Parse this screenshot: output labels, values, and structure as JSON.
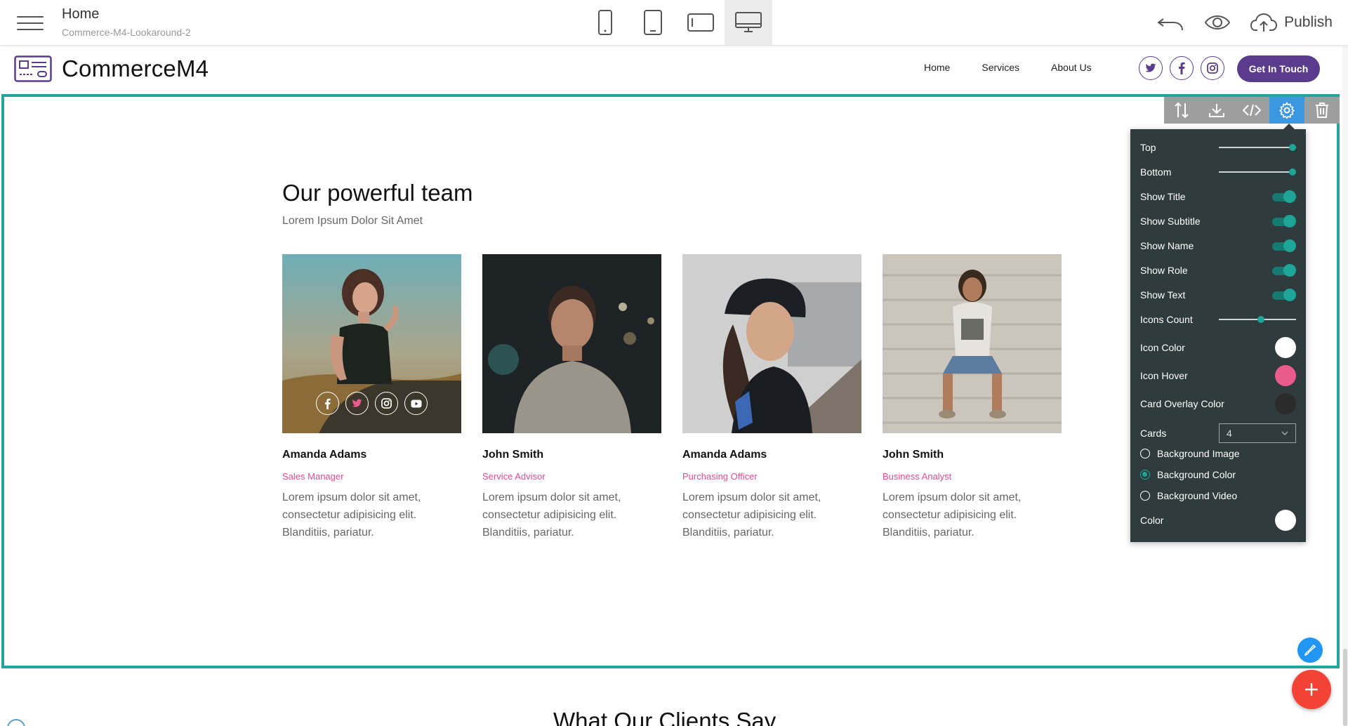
{
  "editor": {
    "page_title": "Home",
    "project_name": "Commerce-M4-Lookaround-2",
    "publish_label": "Publish"
  },
  "site": {
    "brand": "CommerceM4",
    "nav": [
      "Home",
      "Services",
      "About Us"
    ],
    "cta": "Get In Touch"
  },
  "team": {
    "title": "Our powerful team",
    "subtitle": "Lorem Ipsum Dolor Sit Amet",
    "members": [
      {
        "name": "Amanda Adams",
        "role": "Sales Manager",
        "text": "Lorem ipsum dolor sit amet, consectetur adipisicing elit. Blanditiis, pariatur."
      },
      {
        "name": "John Smith",
        "role": "Service Advisor",
        "text": "Lorem ipsum dolor sit amet, consectetur adipisicing elit. Blanditiis, pariatur."
      },
      {
        "name": "Amanda Adams",
        "role": "Purchasing Officer",
        "text": "Lorem ipsum dolor sit amet, consectetur adipisicing elit. Blanditiis, pariatur."
      },
      {
        "name": "John Smith",
        "role": "Business Analyst",
        "text": "Lorem ipsum dolor sit amet, consectetur adipisicing elit. Blanditiis, pariatur."
      }
    ]
  },
  "settings": {
    "top_label": "Top",
    "top_value": 1.0,
    "bottom_label": "Bottom",
    "bottom_value": 1.0,
    "show_title": "Show Title",
    "show_subtitle": "Show Subtitle",
    "show_name": "Show Name",
    "show_role": "Show Role",
    "show_text": "Show Text",
    "icons_count_label": "Icons Count",
    "icons_count_value": 0.55,
    "icon_color_label": "Icon Color",
    "icon_color": "#ffffff",
    "icon_hover_label": "Icon Hover",
    "icon_hover": "#e85b8a",
    "overlay_label": "Card Overlay Color",
    "overlay_color": "#2b2b2b",
    "cards_label": "Cards",
    "cards_value": "4",
    "bg_image": "Background Image",
    "bg_color": "Background Color",
    "bg_video": "Background Video",
    "color_label": "Color",
    "color_value": "#ffffff"
  },
  "next_section_title": "What Our Clients Say",
  "colors": {
    "accent": "#23a59d",
    "brand": "#5b3b8c",
    "role": "#e14d8f",
    "active_tool": "#3a97e0",
    "fab_add": "#f44336",
    "fab_edit": "#2196f3"
  }
}
